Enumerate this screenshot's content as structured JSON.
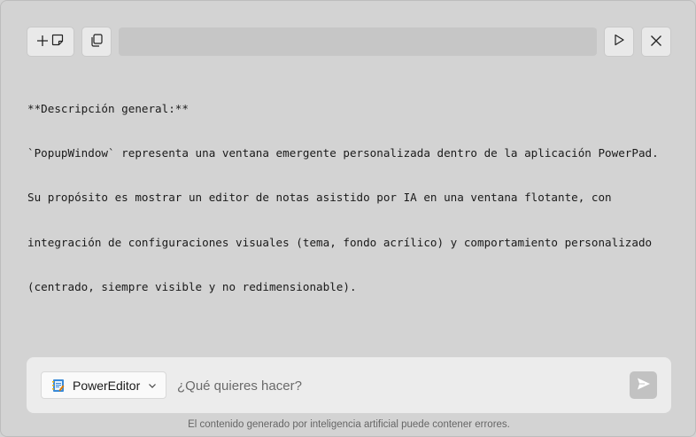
{
  "toolbar": {
    "new_note_icons": [
      "plus-icon",
      "note-icon"
    ],
    "copy_icon": "copy-icon",
    "title": "",
    "run_icon": "play-icon",
    "close_icon": "close-icon"
  },
  "editor": {
    "lines": [
      "**Descripción general:**",
      "`PopupWindow` representa una ventana emergente personalizada dentro de la aplicación PowerPad.",
      "Su propósito es mostrar un editor de notas asistido por IA en una ventana flotante, con",
      "integración de configuraciones visuales (tema, fondo acrílico) y comportamiento personalizado",
      "(centrado, siempre visible y no redimensionable)."
    ]
  },
  "prompt": {
    "mode_label": "PowerEditor",
    "placeholder": "¿Qué quieres hacer?",
    "value": "",
    "send_icon": "send-icon"
  },
  "footer": {
    "disclaimer": "El contenido generado por inteligencia artificial puede contener errores."
  },
  "colors": {
    "background": "#d3d3d3",
    "prompt_bar": "#ececec",
    "send_button": "#c2c2c2"
  }
}
